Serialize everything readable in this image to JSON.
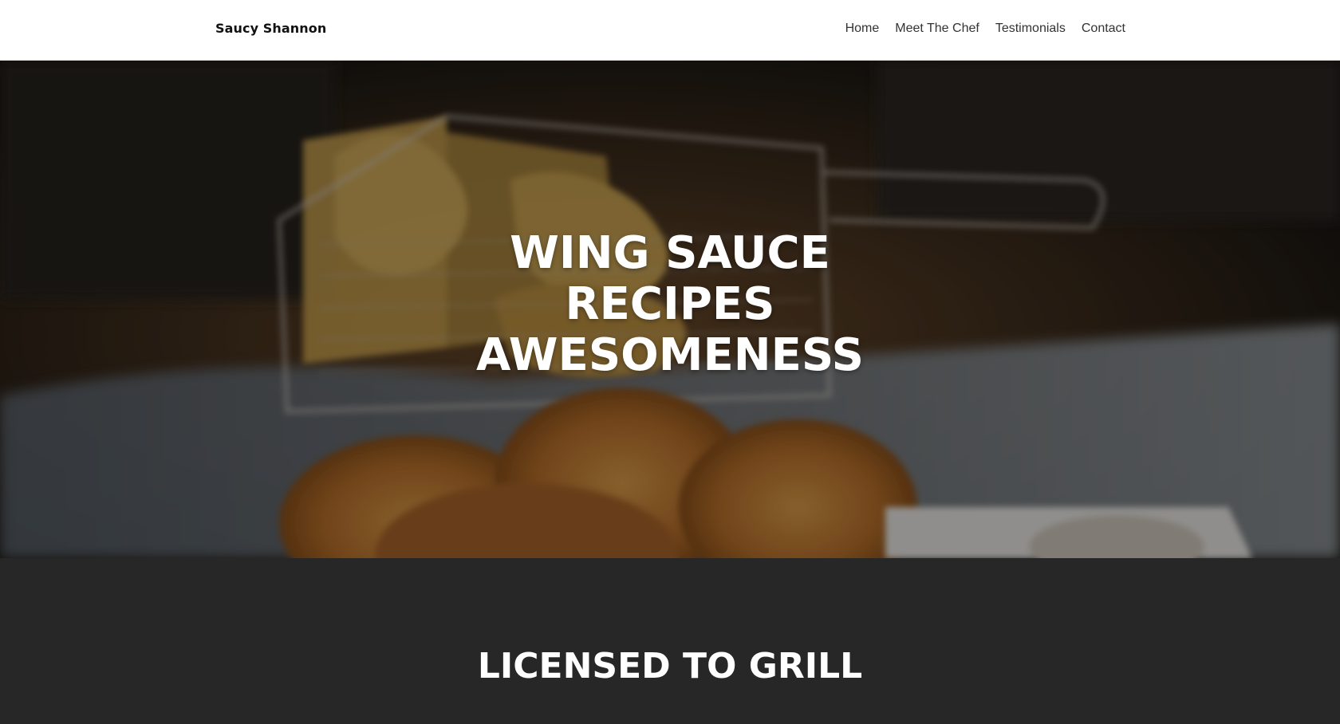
{
  "navbar": {
    "brand": "Saucy Shannon",
    "links": [
      {
        "label": "Home"
      },
      {
        "label": "Meet The Chef"
      },
      {
        "label": "Testimonials"
      },
      {
        "label": "Contact"
      }
    ]
  },
  "hero": {
    "title_lines": [
      "WING SAUCE",
      "RECIPES",
      "AWESOMENESS"
    ],
    "image_description_icon": "fried-food-photo"
  },
  "section": {
    "title": "LICENSED TO GRILL"
  },
  "colors": {
    "navbar_bg": "#ffffff",
    "dark_section_bg": "#272727",
    "hero_text": "#ffffff"
  }
}
